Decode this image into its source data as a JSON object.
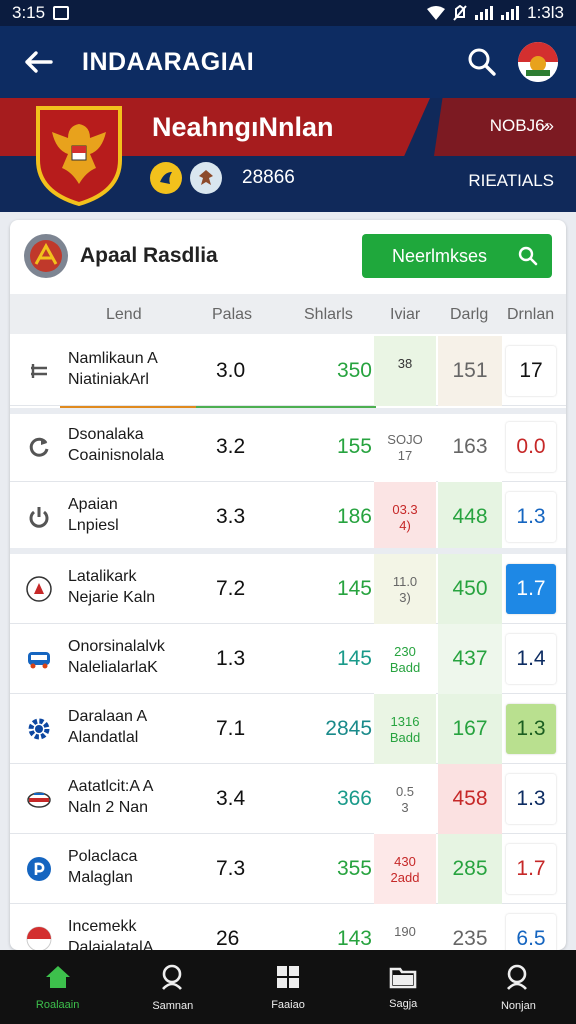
{
  "status": {
    "time": "3:15",
    "clock": "1:3l3"
  },
  "appbar": {
    "title": "INDAARAGIAI"
  },
  "banner": {
    "team_name": "NeahngıNnlan",
    "right_link": "NOBJ6̷»",
    "number": "28866",
    "results_label": "RIEATIALS"
  },
  "card": {
    "title": "Apaal Rasdlia",
    "cta_label": "Neerlmkses"
  },
  "columns": [
    "Lend",
    "Palas",
    "Shlarls",
    "Iviar",
    "Darlg",
    "Drnlan"
  ],
  "rows": [
    {
      "icon": "flag-icon",
      "name1": "Namlikaun A",
      "name2": "NiatiniakArl",
      "palas": "3.0",
      "stats": "350",
      "mar1": "38",
      "mar2": "",
      "darg": "151",
      "drnlan": "17",
      "st_color": "#27a33f",
      "mar_color": "#333333",
      "mar_bg": "#eaf5e4",
      "dg_color": "#666666",
      "dg_bg": "#f6f1e8",
      "dn_color": "#111111",
      "dn_bg": "#ffffff"
    },
    {
      "icon": "refresh-icon",
      "name1": "Dsonalaka",
      "name2": "Coainisnolala",
      "palas": "3.2",
      "stats": "155",
      "mar1": "SOJO",
      "mar2": "17",
      "darg": "163",
      "drnlan": "0.0",
      "st_color": "#27a33f",
      "mar_color": "#666666",
      "mar_bg": "#ffffff",
      "dg_color": "#666666",
      "dg_bg": "#ffffff",
      "dn_color": "#c62828",
      "dn_bg": "#ffffff"
    },
    {
      "icon": "power-icon",
      "name1": "Apaian",
      "name2": "Lnpiesl",
      "palas": "3.3",
      "stats": "186",
      "mar1": "03.3",
      "mar2": "4)",
      "darg": "448",
      "drnlan": "1.3",
      "st_color": "#27a33f",
      "mar_color": "#c62828",
      "mar_bg": "#fbe4e4",
      "dg_color": "#27a33f",
      "dg_bg": "#e6f4e2",
      "dn_color": "#1565c0",
      "dn_bg": "#ffffff"
    },
    {
      "icon": "badge-icon",
      "name1": "Latalikark",
      "name2": "Nejarie Kaln",
      "palas": "7.2",
      "stats": "145",
      "mar1": "11.0",
      "mar2": "3)",
      "darg": "450",
      "drnlan": "1.7",
      "st_color": "#27a33f",
      "mar_color": "#666666",
      "mar_bg": "#f3f5e6",
      "dg_color": "#27a33f",
      "dg_bg": "#e6f4e2",
      "dn_color": "#ffffff",
      "dn_bg": "#1e88e5"
    },
    {
      "icon": "bus-icon",
      "name1": "Onorsinalalvk",
      "name2": "NalelialarlaK",
      "palas": "1.3",
      "stats": "145",
      "mar1": "230",
      "mar2": "Badd",
      "darg": "437",
      "drnlan": "1.4",
      "st_color": "#1a9a8a",
      "mar_color": "#27a33f",
      "mar_bg": "#ffffff",
      "dg_color": "#27a33f",
      "dg_bg": "#eef7ec",
      "dn_color": "#0d2c62",
      "dn_bg": "#ffffff"
    },
    {
      "icon": "gear-icon",
      "name1": "Daralaan A",
      "name2": "Alandatlal",
      "palas": "7.1",
      "stats": "2845",
      "mar1": "1316",
      "mar2": "Badd",
      "darg": "167",
      "drnlan": "1.3",
      "st_color": "#1a8a8a",
      "mar_color": "#27a33f",
      "mar_bg": "#eaf5e4",
      "dg_color": "#27a33f",
      "dg_bg": "#e6f4e2",
      "dn_color": "#1b5e20",
      "dn_bg": "#b9e08f"
    },
    {
      "icon": "car-icon",
      "name1": "Aatatlcit:A A",
      "name2": "Naln 2 Nan",
      "palas": "3.4",
      "stats": "366",
      "mar1": "0.5",
      "mar2": "3",
      "darg": "458",
      "drnlan": "1.3",
      "st_color": "#1a9a8a",
      "mar_color": "#666666",
      "mar_bg": "#ffffff",
      "dg_color": "#c62828",
      "dg_bg": "#fbe1e1",
      "dn_color": "#0d2c62",
      "dn_bg": "#ffffff"
    },
    {
      "icon": "ring-icon",
      "name1": "Polaclaca",
      "name2": "Malaglan",
      "palas": "7.3",
      "stats": "355",
      "mar1": "430",
      "mar2": "2add",
      "darg": "285",
      "drnlan": "1.7",
      "st_color": "#27a33f",
      "mar_color": "#c62828",
      "mar_bg": "#fde8e8",
      "dg_color": "#27a33f",
      "dg_bg": "#e6f4e2",
      "dn_color": "#c62828",
      "dn_bg": "#ffffff"
    },
    {
      "icon": "flag-round-icon",
      "name1": "Incemekk",
      "name2": "DalaialatalA",
      "palas": "26",
      "stats": "143",
      "mar1": "190",
      "mar2": "",
      "darg": "235",
      "drnlan": "6.5",
      "st_color": "#27a33f",
      "mar_color": "#666666",
      "mar_bg": "#ffffff",
      "dg_color": "#666666",
      "dg_bg": "#ffffff",
      "dn_color": "#1565c0",
      "dn_bg": "#ffffff"
    }
  ],
  "nav": [
    {
      "label": "Roalaain",
      "icon": "home-icon",
      "active": true
    },
    {
      "label": "Samnan",
      "icon": "search-icon",
      "active": false
    },
    {
      "label": "Faaiao",
      "icon": "grid-icon",
      "active": false
    },
    {
      "label": "Sagja",
      "icon": "folder-icon",
      "active": false
    },
    {
      "label": "Nonjan",
      "icon": "search-icon",
      "active": false
    }
  ],
  "colors": {
    "primary": "#0d2c62",
    "accent_red": "#a61c1e",
    "accent_green": "#1fa83c",
    "nav_active": "#3dc04c"
  }
}
